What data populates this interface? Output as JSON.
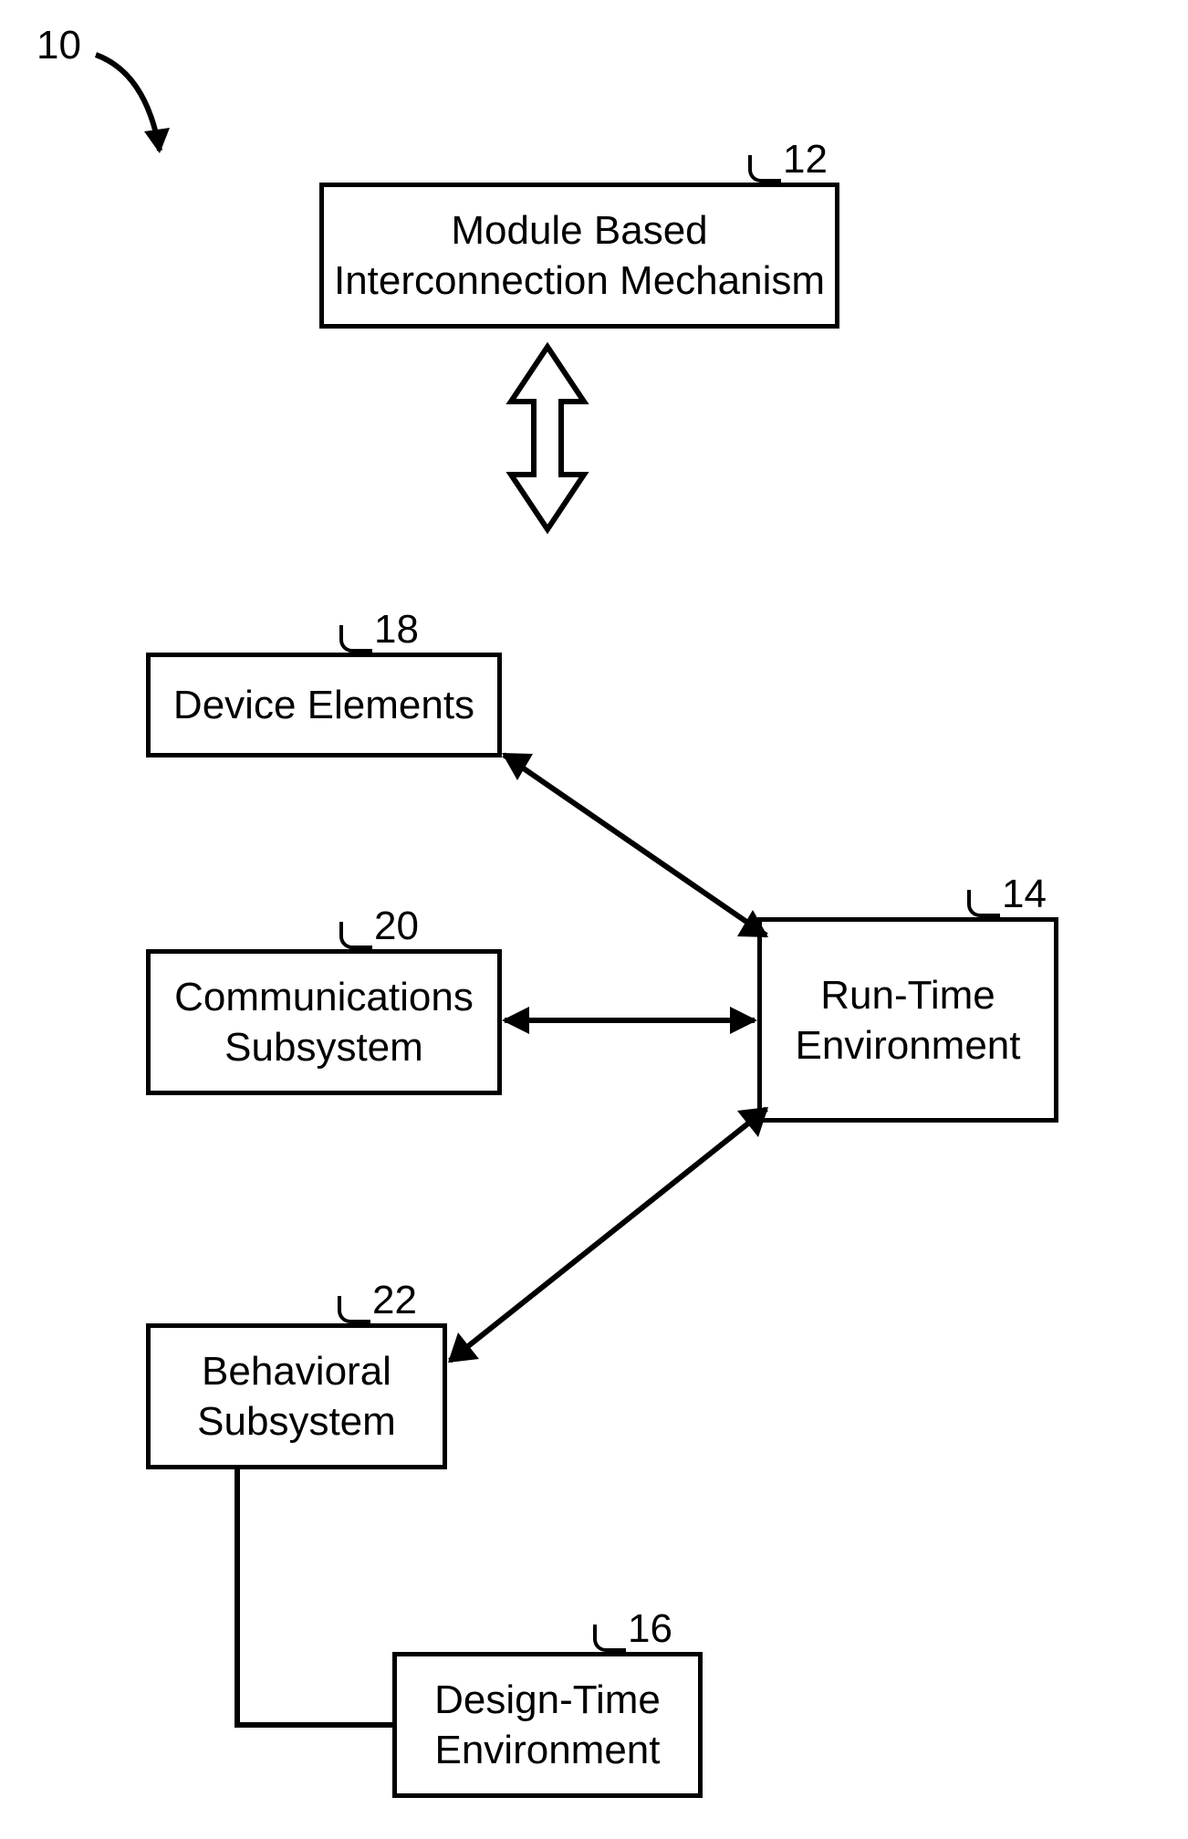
{
  "figure_label": "10",
  "boxes": {
    "interconnection": {
      "ref": "12",
      "label": "Module Based\nInterconnection Mechanism"
    },
    "runtime": {
      "ref": "14",
      "label": "Run-Time\nEnvironment"
    },
    "designtime": {
      "ref": "16",
      "label": "Design-Time\nEnvironment"
    },
    "device": {
      "ref": "18",
      "label": "Device Elements"
    },
    "comms": {
      "ref": "20",
      "label": "Communications\nSubsystem"
    },
    "behavioral": {
      "ref": "22",
      "label": "Behavioral\nSubsystem"
    }
  }
}
